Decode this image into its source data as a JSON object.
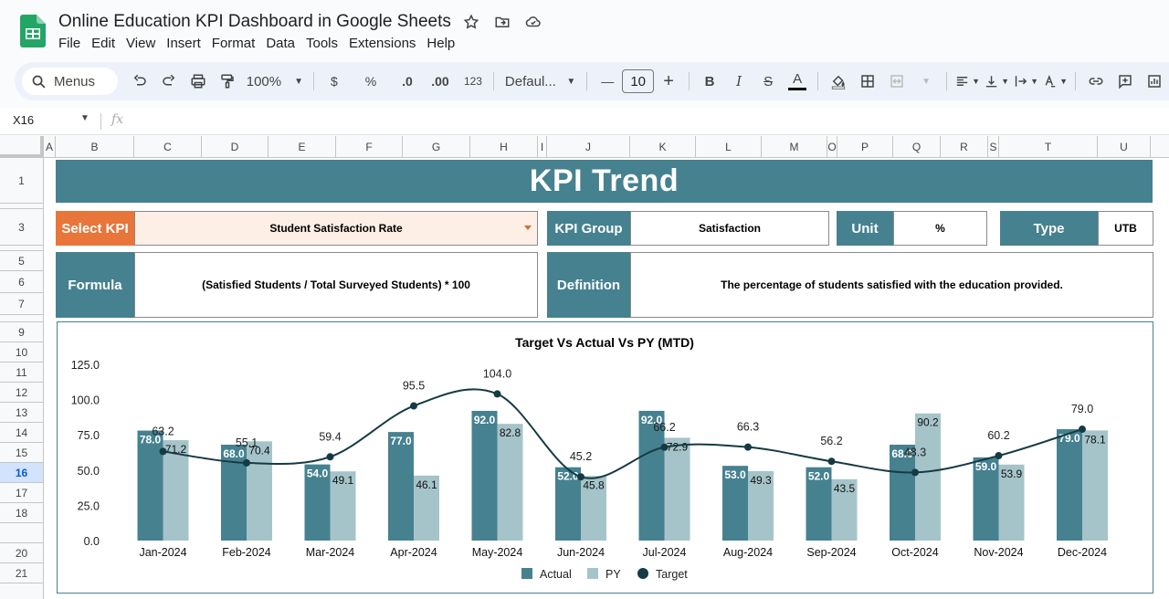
{
  "app": {
    "doc_title": "Online Education KPI Dashboard in Google Sheets",
    "menu": [
      "File",
      "Edit",
      "View",
      "Insert",
      "Format",
      "Data",
      "Tools",
      "Extensions",
      "Help"
    ]
  },
  "toolbar": {
    "menus_label": "Menus",
    "zoom": "100%",
    "currency": "$",
    "percent": "%",
    "dec_decrease": ".0",
    "dec_increase": ".00",
    "number_format": "123",
    "font": "Defaul...",
    "font_size": "10",
    "minus": "—",
    "plus": "+",
    "bold": "B",
    "italic": "I",
    "strike": "S",
    "text_color_letter": "A"
  },
  "formula_bar": {
    "name_box": "X16",
    "fx": "fx"
  },
  "grid": {
    "columns": [
      "A",
      "B",
      "C",
      "D",
      "E",
      "F",
      "G",
      "H",
      "I",
      "J",
      "K",
      "L",
      "M",
      "O",
      "P",
      "Q",
      "R",
      "S",
      "T",
      "U"
    ],
    "rows": [
      "1",
      "3",
      "5",
      "6",
      "7",
      "9",
      "10",
      "11",
      "12",
      "13",
      "14",
      "15",
      "16",
      "17",
      "18",
      "20",
      "21"
    ],
    "selected_row": "16"
  },
  "dashboard": {
    "banner": "KPI Trend",
    "select_kpi_label": "Select KPI",
    "select_kpi_value": "Student Satisfaction Rate",
    "kpi_group_label": "KPI Group",
    "kpi_group_value": "Satisfaction",
    "unit_label": "Unit",
    "unit_value": "%",
    "type_label": "Type",
    "type_value": "UTB",
    "formula_label": "Formula",
    "formula_value": "(Satisfied Students / Total Surveyed Students) * 100",
    "definition_label": "Definition",
    "definition_value": "The percentage of students satisfied with the education provided."
  },
  "colors": {
    "teal": "#468190",
    "light_teal": "#a5c4c9",
    "target_line": "#163a44",
    "orange": "#e8753a",
    "peach": "#fdeee6"
  },
  "chart_data": {
    "type": "bar",
    "title": "Target Vs Actual Vs PY (MTD)",
    "categories": [
      "Jan-2024",
      "Feb-2024",
      "Mar-2024",
      "Apr-2024",
      "May-2024",
      "Jun-2024",
      "Jul-2024",
      "Aug-2024",
      "Sep-2024",
      "Oct-2024",
      "Nov-2024",
      "Dec-2024"
    ],
    "series": [
      {
        "name": "Actual",
        "kind": "bar",
        "values": [
          78.0,
          68.0,
          54.0,
          77.0,
          92.0,
          52.0,
          92.0,
          53.0,
          52.0,
          68.0,
          59.0,
          79.0
        ]
      },
      {
        "name": "PY",
        "kind": "bar",
        "values": [
          71.2,
          70.4,
          49.1,
          46.1,
          82.8,
          45.8,
          72.9,
          49.3,
          43.5,
          90.2,
          53.9,
          78.1
        ]
      },
      {
        "name": "Target",
        "kind": "line",
        "values": [
          63.2,
          55.1,
          59.4,
          95.5,
          104.0,
          45.2,
          66.2,
          66.3,
          56.2,
          48.3,
          60.2,
          79.0
        ]
      }
    ],
    "yticks": [
      "0.0",
      "25.0",
      "50.0",
      "75.0",
      "100.0",
      "125.0"
    ],
    "ylim": [
      0,
      125
    ],
    "legend": "bottom",
    "grid": false
  }
}
